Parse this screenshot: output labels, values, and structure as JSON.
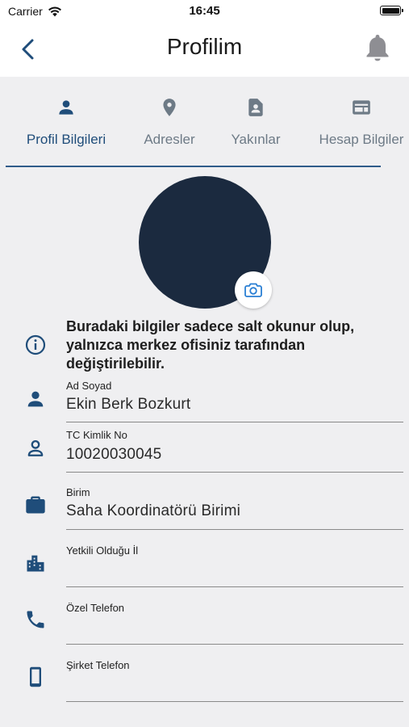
{
  "status_bar": {
    "carrier": "Carrier",
    "time": "16:45"
  },
  "header": {
    "title": "Profilim",
    "back_icon": "chevron-left-icon",
    "bell_icon": "bell-icon"
  },
  "tabs": [
    {
      "label": "Profil Bilgileri",
      "icon": "person-icon",
      "active": true
    },
    {
      "label": "Adresler",
      "icon": "location-pin-icon",
      "active": false
    },
    {
      "label": "Yakınlar",
      "icon": "contact-card-icon",
      "active": false
    },
    {
      "label": "Hesap Bilgiler",
      "icon": "account-card-icon",
      "active": false
    }
  ],
  "notice": {
    "text": "Buradaki bilgiler sadece salt okunur olup, yalnızca merkez ofisiniz tarafından değiştirilebilir."
  },
  "fields": {
    "name": {
      "label": "Ad Soyad",
      "value": "Ekin Berk Bozkurt"
    },
    "tc": {
      "label": "TC Kimlik No",
      "value": "10020030045"
    },
    "unit": {
      "label": "Birim",
      "value": "Saha Koordinatörü Birimi"
    },
    "city": {
      "label": "Yetkili Olduğu İl",
      "value": ""
    },
    "private_phone": {
      "label": "Özel Telefon",
      "value": ""
    },
    "company_phone": {
      "label": "Şirket Telefon",
      "value": ""
    }
  },
  "colors": {
    "accent": "#1f4d7a",
    "icon": "#1f4d7a",
    "inactive_tab": "#6d7a86",
    "avatar": "#1b2a3f",
    "background": "#efeff1"
  }
}
